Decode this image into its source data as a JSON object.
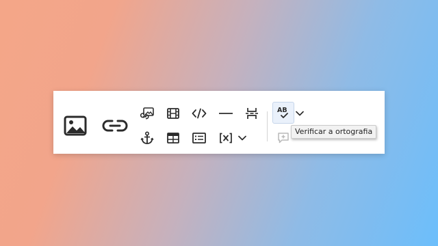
{
  "toolbar": {
    "buttons": [
      {
        "name": "image-button",
        "icon": "image-icon"
      },
      {
        "name": "link-button",
        "icon": "link-icon"
      },
      {
        "name": "embed-link-button",
        "icon": "image-link-icon"
      },
      {
        "name": "anchor-button",
        "icon": "anchor-icon"
      },
      {
        "name": "media-button",
        "icon": "film-icon"
      },
      {
        "name": "table-button",
        "icon": "table-icon"
      },
      {
        "name": "code-button",
        "icon": "code-icon"
      },
      {
        "name": "layout-button",
        "icon": "text-box-icon"
      },
      {
        "name": "horizontal-line-button",
        "icon": "horizontal-line-icon"
      },
      {
        "name": "variable-button",
        "icon": "variable-icon"
      },
      {
        "name": "page-break-button",
        "icon": "page-break-icon"
      },
      {
        "name": "more-insert-dropdown",
        "icon": "chevron-down-icon"
      },
      {
        "name": "spellcheck-button",
        "icon": "spellcheck-icon",
        "active": true
      },
      {
        "name": "spellcheck-dropdown",
        "icon": "chevron-down-icon"
      },
      {
        "name": "comment-button",
        "icon": "add-comment-icon",
        "disabled": true
      }
    ]
  },
  "spellcheck": {
    "icon_text": "AB"
  },
  "tooltip": {
    "text": "Verificar a ortografia"
  },
  "colors": {
    "icon": "#2b2b2b",
    "disabled_icon": "#b8b8b8",
    "active_bg": "#eaf1fb",
    "tooltip_bg": "#f2f2f2"
  }
}
